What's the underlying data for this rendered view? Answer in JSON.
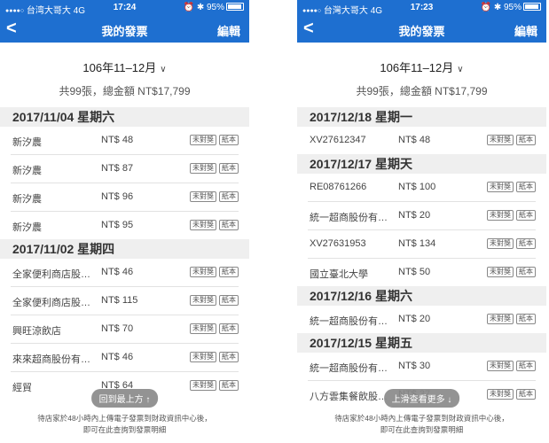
{
  "left": {
    "status": {
      "carrier": "台湾大哥大",
      "network": "4G",
      "time": "17:24",
      "battery": "95%"
    },
    "nav": {
      "back": "<",
      "title": "我的發票",
      "edit": "編輯"
    },
    "period": "106年11–12月",
    "summary": "共99張，總金額 NT$17,799",
    "groups": [
      {
        "date": "2017/11/04 星期六",
        "rows": [
          {
            "store": "新汐農",
            "amount": "NT$ 48",
            "tags": [
              "未對獎",
              "紙本"
            ]
          },
          {
            "store": "新汐農",
            "amount": "NT$ 87",
            "tags": [
              "未對獎",
              "紙本"
            ]
          },
          {
            "store": "新汐農",
            "amount": "NT$ 96",
            "tags": [
              "未對獎",
              "紙本"
            ]
          },
          {
            "store": "新汐農",
            "amount": "NT$ 95",
            "tags": [
              "未對獎",
              "紙本"
            ]
          }
        ]
      },
      {
        "date": "2017/11/02 星期四",
        "rows": [
          {
            "store": "全家便利商店股…",
            "amount": "NT$ 46",
            "tags": [
              "未對獎",
              "紙本"
            ]
          },
          {
            "store": "全家便利商店股…",
            "amount": "NT$ 115",
            "tags": [
              "未對獎",
              "紙本"
            ]
          },
          {
            "store": "興旺涼飲店",
            "amount": "NT$ 70",
            "tags": [
              "未對獎",
              "紙本"
            ]
          },
          {
            "store": "來來超商股份有…",
            "amount": "NT$ 46",
            "tags": [
              "未對獎",
              "紙本"
            ]
          },
          {
            "store": "經貿",
            "amount": "NT$ 64",
            "tags": [
              "未對獎",
              "紙本"
            ]
          }
        ]
      }
    ],
    "floating_button": "回到最上方 ↑",
    "footer_line1": "待店家於48小時內上傳電子發票到財政資訊中心後，",
    "footer_line2": "即可在此查詢到發票明細"
  },
  "right": {
    "status": {
      "carrier": "台灣大哥大",
      "network": "4G",
      "time": "17:23",
      "battery": "95%"
    },
    "nav": {
      "back": "<",
      "title": "我的發票",
      "edit": "編輯"
    },
    "period": "106年11–12月",
    "summary": "共99張，總金額 NT$17,799",
    "groups": [
      {
        "date": "2017/12/18 星期一",
        "rows": [
          {
            "store": "XV27612347",
            "amount": "NT$ 48",
            "tags": [
              "未對獎",
              "紙本"
            ]
          }
        ]
      },
      {
        "date": "2017/12/17 星期天",
        "rows": [
          {
            "store": "RE08761266",
            "amount": "NT$ 100",
            "tags": [
              "未對獎",
              "紙本"
            ]
          },
          {
            "store": "統一超商股份有…",
            "amount": "NT$ 20",
            "tags": [
              "未對獎",
              "紙本"
            ]
          },
          {
            "store": "XV27631953",
            "amount": "NT$ 134",
            "tags": [
              "未對獎",
              "紙本"
            ]
          },
          {
            "store": "國立臺北大學",
            "amount": "NT$ 50",
            "tags": [
              "未對獎",
              "紙本"
            ]
          }
        ]
      },
      {
        "date": "2017/12/16 星期六",
        "rows": [
          {
            "store": "統一超商股份有…",
            "amount": "NT$ 20",
            "tags": [
              "未對獎",
              "紙本"
            ]
          }
        ]
      },
      {
        "date": "2017/12/15 星期五",
        "rows": [
          {
            "store": "統一超商股份有…",
            "amount": "NT$ 30",
            "tags": [
              "未對獎",
              "紙本"
            ]
          },
          {
            "store": "八方雲集餐飲股…",
            "amount": "NT$ 37",
            "tags": [
              "未對獎",
              "紙本"
            ]
          }
        ]
      }
    ],
    "floating_button": "上滑查看更多 ↓",
    "footer_line1": "待店家於48小時內上傳電子發票到財政資訊中心後，",
    "footer_line2": "即可在此查詢到發票明細"
  },
  "colors": {
    "nav_blue": "#1e6fd0",
    "header_gray": "#efefef"
  }
}
